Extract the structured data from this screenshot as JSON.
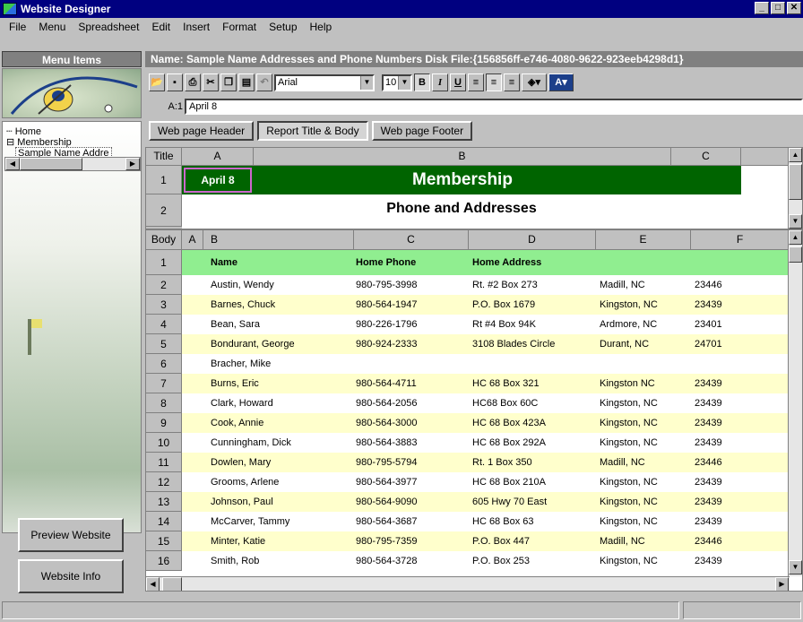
{
  "window": {
    "title": "Website Designer",
    "minimize": "_",
    "maximize": "□",
    "close": "✕"
  },
  "menu": {
    "file": "File",
    "menu": "Menu",
    "spreadsheet": "Spreadsheet",
    "edit": "Edit",
    "insert": "Insert",
    "format": "Format",
    "setup": "Setup",
    "help": "Help"
  },
  "left_panel": {
    "header": "Menu Items",
    "tree": {
      "home": "Home",
      "membership": "Membership",
      "child": "Sample Name Addre"
    },
    "preview_button": "Preview Website",
    "info_button": "Website Info"
  },
  "name_bar": "Name: Sample Name Addresses and Phone Numbers   Disk File:{156856ff-e746-4080-9622-923eeb4298d1}",
  "toolbar": {
    "font": "Arial",
    "size": "10",
    "bold": "B",
    "italic": "I",
    "underline": "U",
    "font_color": "A"
  },
  "cell_ref": {
    "address": "A:1",
    "value": "April 8"
  },
  "tabs": {
    "header": "Web page Header",
    "body": "Report Title & Body",
    "footer": "Web page Footer"
  },
  "title_grid": {
    "corner": "Title",
    "columns": [
      "A",
      "B",
      "C"
    ],
    "rows": [
      "1",
      "2"
    ],
    "date": "April 8",
    "title": "Membership",
    "subtitle": "Phone and Addresses"
  },
  "body_grid": {
    "corner": "Body",
    "columns": [
      "A",
      "B",
      "C",
      "D",
      "E",
      "F"
    ],
    "header_row": {
      "num": "1",
      "name": "Name",
      "phone": "Home Phone",
      "address": "Home Address"
    },
    "rows": [
      {
        "num": "2",
        "name": "Austin, Wendy",
        "phone": "980-795-3998",
        "address": "Rt. #2  Box 273",
        "city": "Madill, NC",
        "zip": "23446"
      },
      {
        "num": "3",
        "name": "Barnes, Chuck",
        "phone": "980-564-1947",
        "address": "P.O. Box 1679",
        "city": "Kingston, NC",
        "zip": "23439"
      },
      {
        "num": "4",
        "name": "Bean, Sara",
        "phone": "980-226-1796",
        "address": "Rt #4  Box 94K",
        "city": "Ardmore, NC",
        "zip": "23401"
      },
      {
        "num": "5",
        "name": "Bondurant, George",
        "phone": "980-924-2333",
        "address": "3108 Blades Circle",
        "city": "Durant, NC",
        "zip": "24701"
      },
      {
        "num": "6",
        "name": "Bracher, Mike",
        "phone": "",
        "address": "",
        "city": "",
        "zip": ""
      },
      {
        "num": "7",
        "name": "Burns, Eric",
        "phone": "980-564-4711",
        "address": "HC 68 Box 321",
        "city": "Kingston NC",
        "zip": "23439"
      },
      {
        "num": "8",
        "name": "Clark, Howard",
        "phone": "980-564-2056",
        "address": "HC68 Box 60C",
        "city": "Kingston, NC",
        "zip": "23439"
      },
      {
        "num": "9",
        "name": "Cook, Annie",
        "phone": "980-564-3000",
        "address": "HC 68 Box 423A",
        "city": "Kingston, NC",
        "zip": "23439"
      },
      {
        "num": "10",
        "name": "Cunningham, Dick",
        "phone": "980-564-3883",
        "address": "HC 68 Box 292A",
        "city": "Kingston, NC",
        "zip": "23439"
      },
      {
        "num": "11",
        "name": "Dowlen, Mary",
        "phone": "980-795-5794",
        "address": "Rt. 1 Box 350",
        "city": "Madill, NC",
        "zip": "23446"
      },
      {
        "num": "12",
        "name": "Grooms, Arlene",
        "phone": "980-564-3977",
        "address": "HC 68 Box 210A",
        "city": "Kingston, NC",
        "zip": "23439"
      },
      {
        "num": "13",
        "name": "Johnson, Paul",
        "phone": "980-564-9090",
        "address": "605 Hwy 70 East",
        "city": "Kingston, NC",
        "zip": "23439"
      },
      {
        "num": "14",
        "name": "McCarver, Tammy",
        "phone": "980-564-3687",
        "address": "HC 68 Box 63",
        "city": "Kingston, NC",
        "zip": "23439"
      },
      {
        "num": "15",
        "name": "Minter, Katie",
        "phone": "980-795-7359",
        "address": "P.O. Box 447",
        "city": "Madill, NC",
        "zip": "23446"
      },
      {
        "num": "16",
        "name": "Smith, Rob",
        "phone": "980-564-3728",
        "address": "P.O.  Box 253",
        "city": "Kingston, NC",
        "zip": "23439"
      }
    ]
  },
  "colors": {
    "title_green": "#006400",
    "header_light_green": "#90ee90",
    "stripe_yellow": "#ffffcc",
    "date_border": "#cc66cc"
  }
}
